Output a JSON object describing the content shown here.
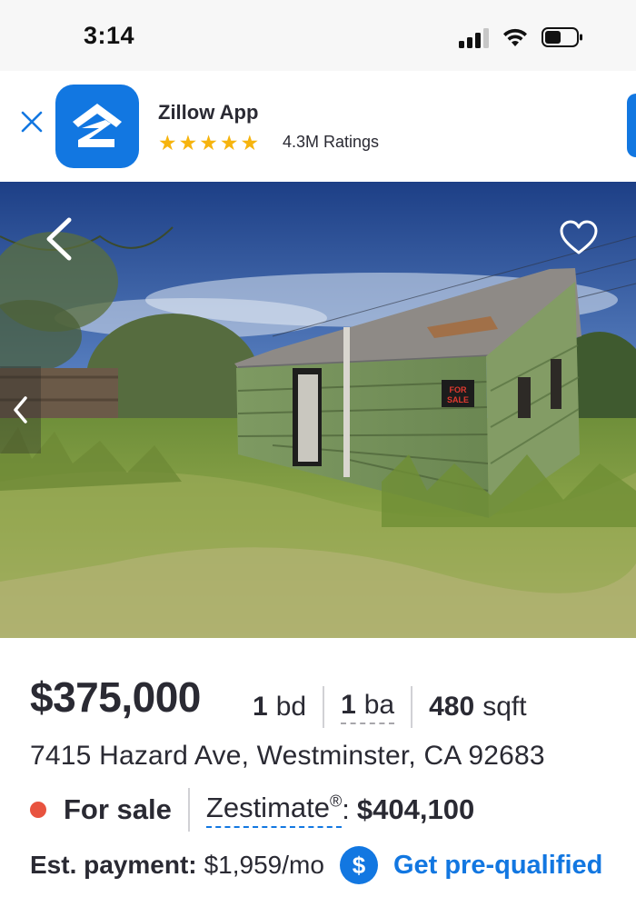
{
  "status_bar": {
    "time": "3:14",
    "icons": [
      "signal-icon",
      "wifi-icon",
      "battery-icon"
    ]
  },
  "app_banner": {
    "app_name": "Zillow App",
    "star_count": 5,
    "ratings_text": "4.3M Ratings",
    "icons": [
      "close-icon",
      "zillow-logo-icon"
    ]
  },
  "photo": {
    "icons": [
      "back-chevron-icon",
      "heart-icon",
      "previous-photo-icon"
    ],
    "sign_text_line1": "FOR",
    "sign_text_line2": "SALE"
  },
  "listing": {
    "price": "$375,000",
    "beds_value": "1",
    "beds_unit": "bd",
    "baths_value": "1",
    "baths_unit": "ba",
    "sqft_value": "480",
    "sqft_unit": "sqft",
    "address": "7415 Hazard Ave, Westminster, CA 92683",
    "status": "For sale",
    "zestimate_label": "Zestimate",
    "zestimate_mark": "®",
    "zestimate_colon": ":",
    "zestimate_value": "$404,100",
    "payment_label": "Est. payment:",
    "payment_value": "$1,959/mo",
    "prequal_icon_glyph": "$",
    "prequal_link": "Get pre-qualified"
  },
  "colors": {
    "brand_blue": "#1277e1",
    "status_red": "#e8533f",
    "star_gold": "#f6b40e",
    "text_dark": "#2a2a33"
  }
}
